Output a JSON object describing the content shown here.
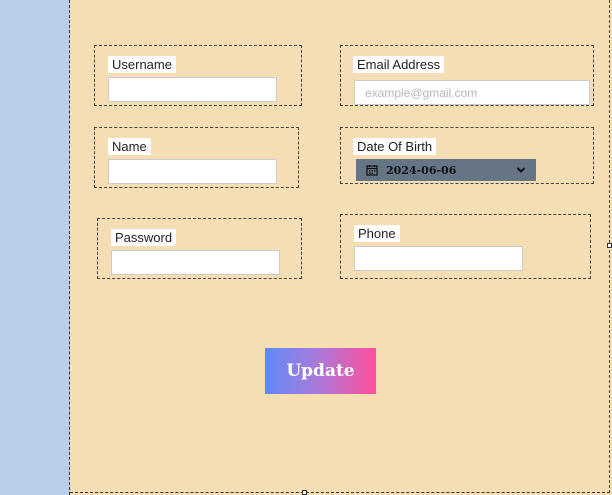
{
  "form": {
    "username_label": "Username",
    "username_value": "",
    "email_label": "Email Address",
    "email_placeholder": "example@gmail.com",
    "name_label": "Name",
    "name_value": "",
    "dob_label": "Date Of Birth",
    "dob_value": "2024-06-06",
    "password_label": "Password",
    "password_value": "",
    "phone_label": "Phone",
    "phone_value": "",
    "update_label": "Update"
  },
  "colors": {
    "sidebar": "#b8d0ea",
    "main_background": "#f6deb4",
    "date_field": "#667585",
    "button_gradient": [
      "#5f8bf7",
      "#ff4f9b"
    ]
  },
  "icons": {
    "date": "calendar-icon",
    "dropdown": "chevron-down-icon"
  }
}
